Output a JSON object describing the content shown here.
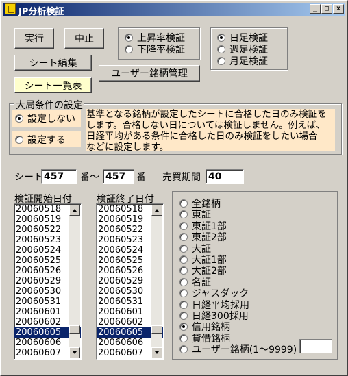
{
  "window": {
    "title": "JP分析検証",
    "minimize": "_",
    "maximize": "□",
    "close": "x"
  },
  "buttons": {
    "run": "実行",
    "stop": "中止",
    "sheet_edit": "シート編集",
    "sheet_list": "シート一覧表",
    "user_stock_manage": "ユーザー銘柄管理"
  },
  "verify_mode": {
    "options": [
      "上昇率検証",
      "下降率検証"
    ],
    "selected": "上昇率検証"
  },
  "timeframe": {
    "options": [
      "日足検証",
      "週足検証",
      "月足検証"
    ],
    "selected": "日足検証"
  },
  "market_condition": {
    "title": "大局条件の設定",
    "options": [
      "設定しない",
      "設定する"
    ],
    "selected": "設定しない",
    "note_lines": [
      "基準となる銘柄が設定したシートに合格した日のみ検証を",
      "します。合格しない日については検証しません。例えば、",
      "日経平均がある条件に合格した日のみ検証をしたい場合",
      "などに設定します。"
    ]
  },
  "sheet_range": {
    "label": "シート",
    "from": "457",
    "mid_label": "番～",
    "to": "457",
    "end_label": "番"
  },
  "holding_period": {
    "label": "売買期間",
    "value": "40"
  },
  "start_date_list": {
    "label": "検証開始日付",
    "items": [
      "20060518",
      "20060519",
      "20060522",
      "20060523",
      "20060524",
      "20060525",
      "20060526",
      "20060529",
      "20060530",
      "20060531",
      "20060601",
      "20060602",
      "20060605",
      "20060606",
      "20060607"
    ],
    "selected": "20060605"
  },
  "end_date_list": {
    "label": "検証終了日付",
    "items": [
      "20060518",
      "20060519",
      "20060522",
      "20060523",
      "20060524",
      "20060525",
      "20060526",
      "20060529",
      "20060530",
      "20060531",
      "20060601",
      "20060602",
      "20060605",
      "20060606",
      "20060607"
    ],
    "selected": "20060605"
  },
  "stock_universe": {
    "options": [
      "全銘柄",
      "東証",
      "東証1部",
      "東証2部",
      "大証",
      "大証1部",
      "大証2部",
      "名証",
      "ジャスダック",
      "日経平均採用",
      "日経300採用",
      "信用銘柄",
      "貸借銘柄",
      "ユーザー銘柄(1～9999)"
    ],
    "selected": "信用銘柄",
    "user_range_value": ""
  },
  "colors": {
    "face": "#d4d0c8",
    "title_active": "#0a246a",
    "selection": "#0a246a",
    "button_highlight": "#ffffcc",
    "note_background": "#ffe8c8"
  }
}
